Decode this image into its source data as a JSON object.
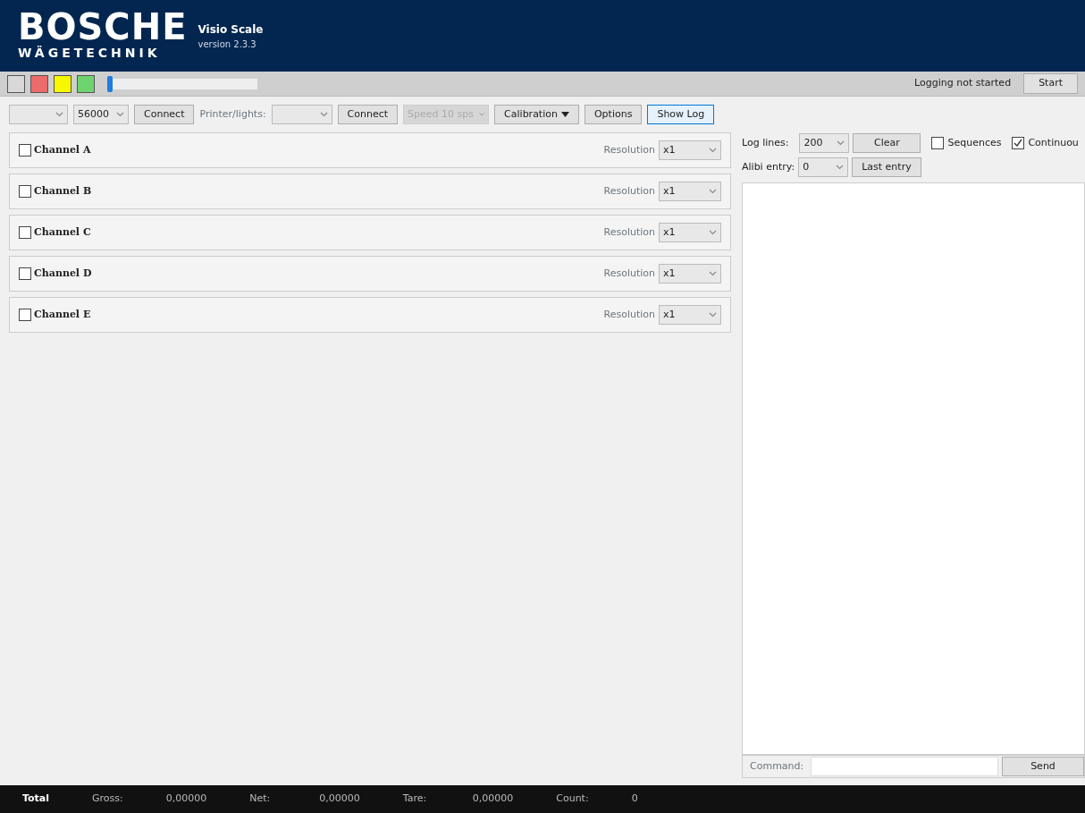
{
  "header": {
    "logo": "BOSCHE",
    "logo_sub": "WÄGETECHNIK",
    "app_name": "Visio Scale",
    "version": "version 2.3.3"
  },
  "status_bar": {
    "lights": [
      {
        "color": "#d8d8d8"
      },
      {
        "color": "#ec6b6b"
      },
      {
        "color": "#f7f700"
      },
      {
        "color": "#6fd46f"
      }
    ],
    "slider": {
      "level": 0
    },
    "logging_status": "Logging not started",
    "start_button": "Start"
  },
  "toolbar": [
    {
      "kind": "select"
    },
    {
      "kind": "select",
      "value": "56000"
    },
    {
      "kind": "button",
      "label": "Connect",
      "selected": false
    },
    {
      "kind": "label",
      "label": "Printer/lights:"
    },
    {
      "kind": "select"
    },
    {
      "kind": "button",
      "label": "Connect",
      "selected": false
    },
    {
      "kind": "select",
      "value": "Speed 10 sps",
      "disabled": true
    },
    {
      "kind": "split",
      "label": "Calibration",
      "selected": false
    },
    {
      "kind": "button",
      "label": "Options",
      "selected": false
    },
    {
      "kind": "button",
      "label": "Show Log",
      "selected": true
    }
  ],
  "channels": [
    {
      "name": "Channel A",
      "checked": false,
      "resolution_label": "Resolution",
      "resolution": "x1"
    },
    {
      "name": "Channel B",
      "checked": false,
      "resolution_label": "Resolution",
      "resolution": "x1"
    },
    {
      "name": "Channel C",
      "checked": false,
      "resolution_label": "Resolution",
      "resolution": "x1"
    },
    {
      "name": "Channel D",
      "checked": false,
      "resolution_label": "Resolution",
      "resolution": "x1"
    },
    {
      "name": "Channel E",
      "checked": false,
      "resolution_label": "Resolution",
      "resolution": "x1"
    }
  ],
  "log": {
    "log_lines_label": "Log lines:",
    "log_lines": "200",
    "clear_button": "Clear",
    "sequences": {
      "label": "Sequences",
      "checked": false
    },
    "continuous": {
      "label": "Continuou",
      "checked": true
    },
    "alibi_label": "Alibi entry:",
    "alibi": "0",
    "last_entry_button": "Last entry",
    "command_label": "Command:",
    "send_button": "Send"
  },
  "totals": {
    "title": "Total",
    "items": [
      {
        "label": "Gross:",
        "value": "0,00000"
      },
      {
        "label": "Net:",
        "value": "0,00000"
      },
      {
        "label": "Tare:",
        "value": "0,00000"
      },
      {
        "label": "Count:",
        "value": "0"
      }
    ]
  }
}
